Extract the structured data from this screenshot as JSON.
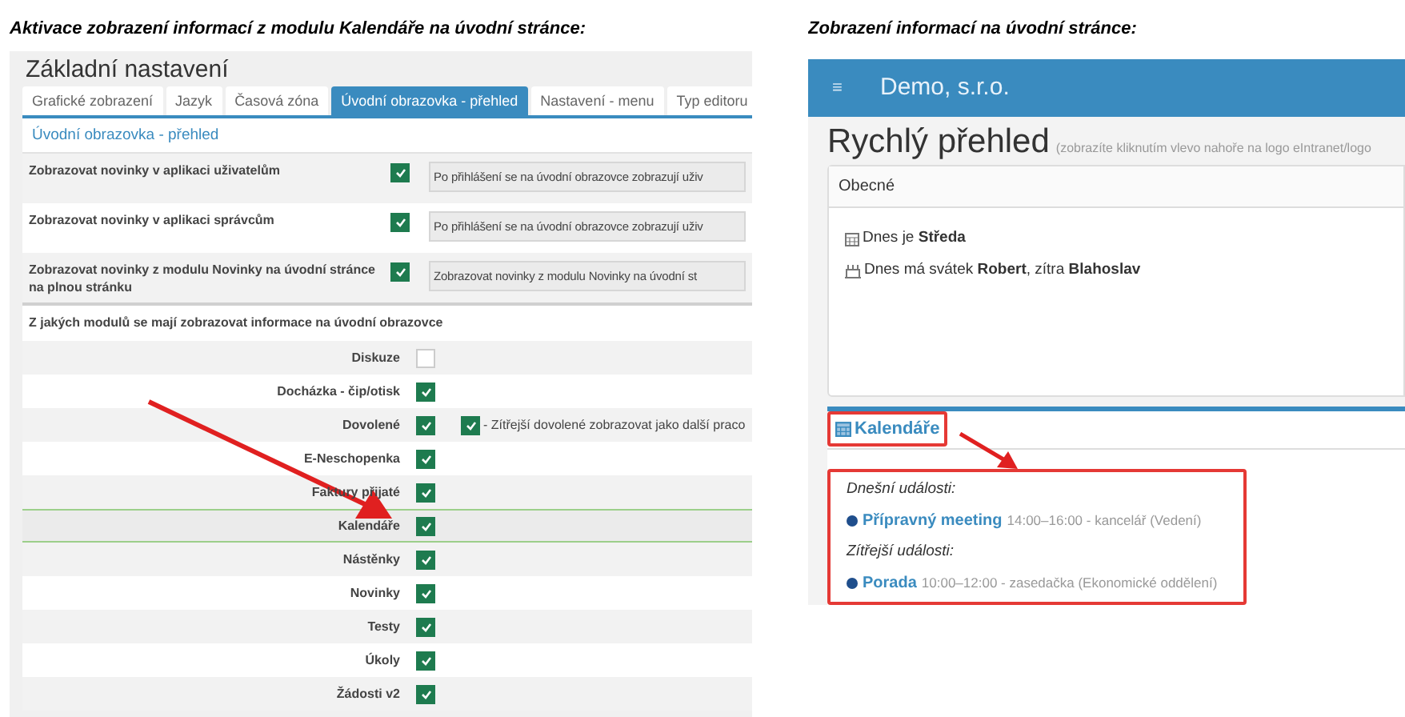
{
  "left": {
    "caption": "Aktivace zobrazení informací z modulu Kalendáře na úvodní stránce:",
    "panel_title": "Základní nastavení",
    "tabs": [
      {
        "label": "Grafické zobrazení",
        "selected": false
      },
      {
        "label": "Jazyk",
        "selected": false
      },
      {
        "label": "Časová zóna",
        "selected": false
      },
      {
        "label": "Úvodní obrazovka - přehled",
        "selected": true
      },
      {
        "label": "Nastavení - menu",
        "selected": false
      },
      {
        "label": "Typ editoru",
        "selected": false
      }
    ],
    "section_title": "Úvodní obrazovka - přehled",
    "settings": [
      {
        "label": "Zobrazovat novinky v aplikaci uživatelům",
        "checked": true,
        "description": "Po přihlášení se na úvodní obrazovce zobrazují uživ"
      },
      {
        "label": "Zobrazovat novinky v aplikaci správcům",
        "checked": true,
        "description": "Po přihlášení se na úvodní obrazovce zobrazují uživ"
      },
      {
        "label": "Zobrazovat novinky z modulu Novinky na úvodní stránce na plnou stránku",
        "checked": true,
        "description": "Zobrazovat novinky z modulu Novinky na úvodní st"
      }
    ],
    "modules_heading": "Z jakých modulů se mají zobrazovat informace na úvodní obrazovce",
    "modules": [
      {
        "label": "Diskuze",
        "checked": false,
        "selected": false
      },
      {
        "label": "Docházka - čip/otisk",
        "checked": true,
        "selected": false
      },
      {
        "label": "Dovolené",
        "checked": true,
        "selected": false,
        "option": {
          "label": "- Zítřejší dovolené zobrazovat jako další praco",
          "checked": true
        }
      },
      {
        "label": "E-Neschopenka",
        "checked": true,
        "selected": false
      },
      {
        "label": "Faktury přijaté",
        "checked": true,
        "selected": false
      },
      {
        "label": "Kalendáře",
        "checked": true,
        "selected": true
      },
      {
        "label": "Nástěnky",
        "checked": true,
        "selected": false
      },
      {
        "label": "Novinky",
        "checked": true,
        "selected": false
      },
      {
        "label": "Testy",
        "checked": true,
        "selected": false
      },
      {
        "label": "Úkoly",
        "checked": true,
        "selected": false
      },
      {
        "label": "Žádosti v2",
        "checked": true,
        "selected": false
      }
    ]
  },
  "right": {
    "caption": "Zobrazení informací na úvodní stránce:",
    "menu_icon": "≡",
    "app_title": "Demo, s.r.o.",
    "page_title": "Rychlý přehled",
    "page_subtitle": "(zobrazíte kliknutím vlevo nahoře na logo eIntranet/logo",
    "general_card": {
      "title": "Obecné",
      "lines": [
        {
          "kind": "calendar",
          "text": "Dnes je **Středa**"
        },
        {
          "kind": "cake",
          "text": "Dnes má svátek **Robert**, zítra **Blahoslav**"
        }
      ]
    },
    "calendar_card": {
      "title": "Kalendáře",
      "highlighted": true,
      "groups": [
        {
          "heading": "Dnešní události:",
          "events": [
            {
              "title": "Přípravný meeting",
              "details": "14:00–16:00 - kancelář (Vedení)",
              "color": "#1f4e8c"
            }
          ]
        },
        {
          "heading": "Zítřejší události:",
          "events": [
            {
              "title": "Porada",
              "details": "10:00–12:00 - zasedačka (Ekonomické oddělení)",
              "color": "#1f4e8c"
            }
          ]
        }
      ]
    }
  }
}
